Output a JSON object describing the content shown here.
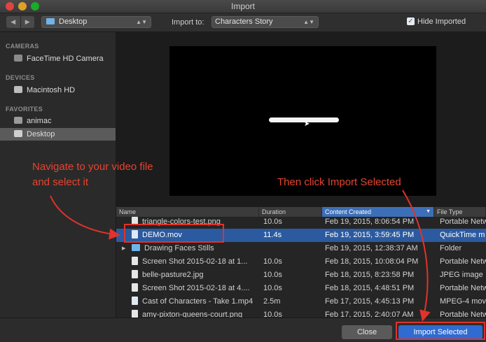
{
  "window": {
    "title": "Import"
  },
  "toolbar": {
    "back_icon": "chevron-left-icon",
    "forward_icon": "chevron-right-icon",
    "location": "Desktop",
    "import_to_label": "Import to:",
    "import_to_value": "Characters Story",
    "hide_imported_label": "Hide Imported",
    "hide_imported_checked": true
  },
  "sidebar": {
    "sections": [
      {
        "heading": "CAMERAS",
        "items": [
          {
            "label": "FaceTime HD Camera",
            "icon": "camera-icon"
          }
        ]
      },
      {
        "heading": "DEVICES",
        "items": [
          {
            "label": "Macintosh HD",
            "icon": "disk-icon"
          }
        ]
      },
      {
        "heading": "FAVORITES",
        "items": [
          {
            "label": "animac",
            "icon": "home-icon"
          },
          {
            "label": "Desktop",
            "icon": "desktop-icon",
            "selected": true
          }
        ]
      }
    ]
  },
  "file_list": {
    "columns": [
      "Name",
      "Duration",
      "Content Created",
      "File Type"
    ],
    "sorted_column": "Content Created",
    "rows": [
      {
        "name": "triangle-colors-test.png",
        "duration": "10.0s",
        "created": "Feb 19, 2015, 8:06:54 PM",
        "type": "Portable Netw",
        "kind": "file"
      },
      {
        "name": "DEMO.mov",
        "duration": "11.4s",
        "created": "Feb 19, 2015, 3:59:45 PM",
        "type": "QuickTime m",
        "kind": "movie",
        "selected": true
      },
      {
        "name": "Drawing Faces Stills",
        "duration": "",
        "created": "Feb 19, 2015, 12:38:37 AM",
        "type": "Folder",
        "kind": "folder"
      },
      {
        "name": "Screen Shot 2015-02-18 at 1...",
        "duration": "10.0s",
        "created": "Feb 18, 2015, 10:08:04 PM",
        "type": "Portable Netw",
        "kind": "file"
      },
      {
        "name": "belle-pasture2.jpg",
        "duration": "10.0s",
        "created": "Feb 18, 2015, 8:23:58 PM",
        "type": "JPEG image",
        "kind": "file"
      },
      {
        "name": "Screen Shot 2015-02-18 at 4....",
        "duration": "10.0s",
        "created": "Feb 18, 2015, 4:48:51 PM",
        "type": "Portable Netw",
        "kind": "file"
      },
      {
        "name": "Cast of Characters - Take 1.mp4",
        "duration": "2.5m",
        "created": "Feb 17, 2015, 4:45:13 PM",
        "type": "MPEG-4 mov",
        "kind": "movie"
      },
      {
        "name": "amy-pixton-queens-court.png",
        "duration": "10.0s",
        "created": "Feb 17, 2015, 2:40:07 AM",
        "type": "Portable Netw",
        "kind": "file"
      }
    ]
  },
  "buttons": {
    "close": "Close",
    "import_selected": "Import Selected"
  },
  "annotations": {
    "step1": "Navigate to your video file and select it",
    "step2": "Then click Import Selected",
    "color": "#e8432f"
  }
}
